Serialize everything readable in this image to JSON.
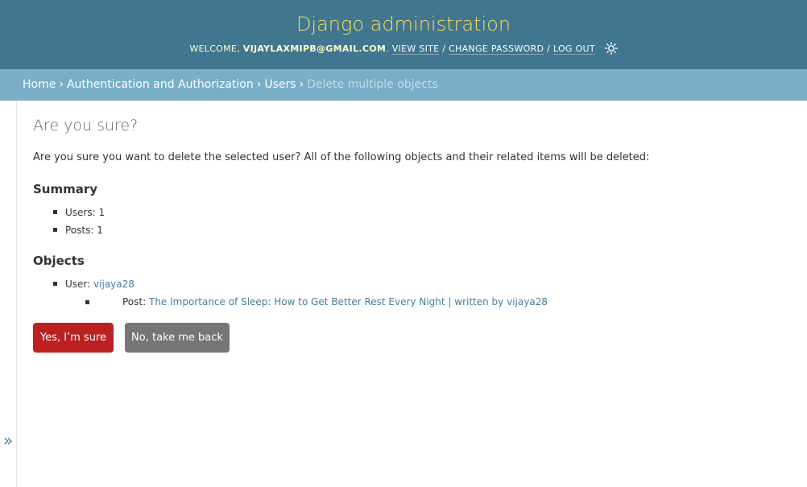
{
  "header": {
    "site_name": "Django administration",
    "welcome_prefix": "Welcome,",
    "username": "vijaylaxmipb@gmail.com",
    "username_suffix": ".",
    "view_site": "View site",
    "change_password": "Change password",
    "log_out": "Log out",
    "separator": "/",
    "theme_icon": "sun-icon"
  },
  "breadcrumbs": {
    "home": "Home",
    "app": "Authentication and Authorization",
    "model": "Users",
    "current": "Delete multiple objects",
    "separator": "›"
  },
  "sidebar": {
    "toggle_glyph": "»"
  },
  "content": {
    "title": "Are you sure?",
    "intro": "Are you sure you want to delete the selected user? All of the following objects and their related items will be deleted:",
    "summary_heading": "Summary",
    "summary": [
      {
        "label": "Users:",
        "count": "1"
      },
      {
        "label": "Posts:",
        "count": "1"
      }
    ],
    "objects_heading": "Objects",
    "objects": {
      "user_label": "User:",
      "user_link": "vijaya28",
      "post_label": "Post:",
      "post_link": "The Importance of Sleep: How to Get Better Rest Every Night | written by vijaya28"
    },
    "confirm_button": "Yes, I’m sure",
    "cancel_button": "No, take me back"
  },
  "colors": {
    "header_bg": "#417690",
    "branding": "#f5dd5d",
    "breadcrumbs_bg": "#79aec8",
    "link": "#447e9b",
    "delete_button": "#ba2121",
    "cancel_button": "#757575"
  }
}
